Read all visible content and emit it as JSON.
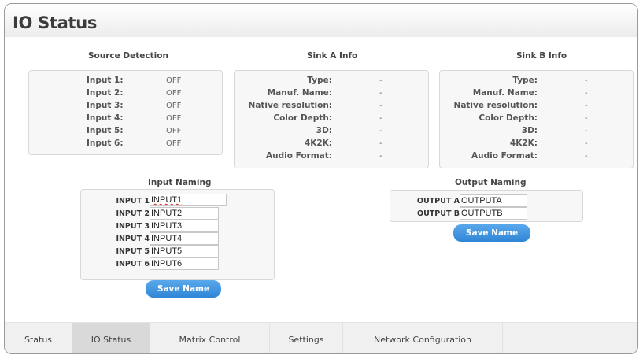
{
  "page": {
    "title": "IO Status"
  },
  "source_detection": {
    "title": "Source Detection",
    "rows": [
      {
        "label": "Input 1:",
        "value": "OFF"
      },
      {
        "label": "Input 2:",
        "value": "OFF"
      },
      {
        "label": "Input 3:",
        "value": "OFF"
      },
      {
        "label": "Input 4:",
        "value": "OFF"
      },
      {
        "label": "Input 5:",
        "value": "OFF"
      },
      {
        "label": "Input 6:",
        "value": "OFF"
      }
    ]
  },
  "sink_a": {
    "title": "Sink A Info",
    "rows": [
      {
        "label": "Type:",
        "value": "-"
      },
      {
        "label": "Manuf. Name:",
        "value": "-"
      },
      {
        "label": "Native resolution:",
        "value": "-"
      },
      {
        "label": "Color Depth:",
        "value": "-"
      },
      {
        "label": "3D:",
        "value": "-"
      },
      {
        "label": "4K2K:",
        "value": "-"
      },
      {
        "label": "Audio Format:",
        "value": "-"
      }
    ]
  },
  "sink_b": {
    "title": "Sink B Info",
    "rows": [
      {
        "label": "Type:",
        "value": "-"
      },
      {
        "label": "Manuf. Name:",
        "value": "-"
      },
      {
        "label": "Native resolution:",
        "value": "-"
      },
      {
        "label": "Color Depth:",
        "value": "-"
      },
      {
        "label": "3D:",
        "value": "-"
      },
      {
        "label": "4K2K:",
        "value": "-"
      },
      {
        "label": "Audio Format:",
        "value": "-"
      }
    ]
  },
  "input_naming": {
    "title": "Input Naming",
    "rows": [
      {
        "label": "INPUT 1",
        "value": "INPUT1"
      },
      {
        "label": "INPUT 2",
        "value": "INPUT2"
      },
      {
        "label": "INPUT 3",
        "value": "INPUT3"
      },
      {
        "label": "INPUT 4",
        "value": "INPUT4"
      },
      {
        "label": "INPUT 5",
        "value": "INPUT5"
      },
      {
        "label": "INPUT 6",
        "value": "INPUT6"
      }
    ],
    "save_label": "Save Name"
  },
  "output_naming": {
    "title": "Output Naming",
    "rows": [
      {
        "label": "OUTPUT A",
        "value": "OUTPUTA"
      },
      {
        "label": "OUTPUT B",
        "value": "OUTPUTB"
      }
    ],
    "save_label": "Save Name"
  },
  "tabs": [
    {
      "label": "Status",
      "active": false
    },
    {
      "label": "IO Status",
      "active": true
    },
    {
      "label": "Matrix Control",
      "active": false
    },
    {
      "label": "Settings",
      "active": false
    },
    {
      "label": "Network Configuration",
      "active": false
    }
  ],
  "colors": {
    "accent": "#3a8fdc",
    "active_tab": "#d9d9d9",
    "tab_bar": "#f0f0f0"
  }
}
